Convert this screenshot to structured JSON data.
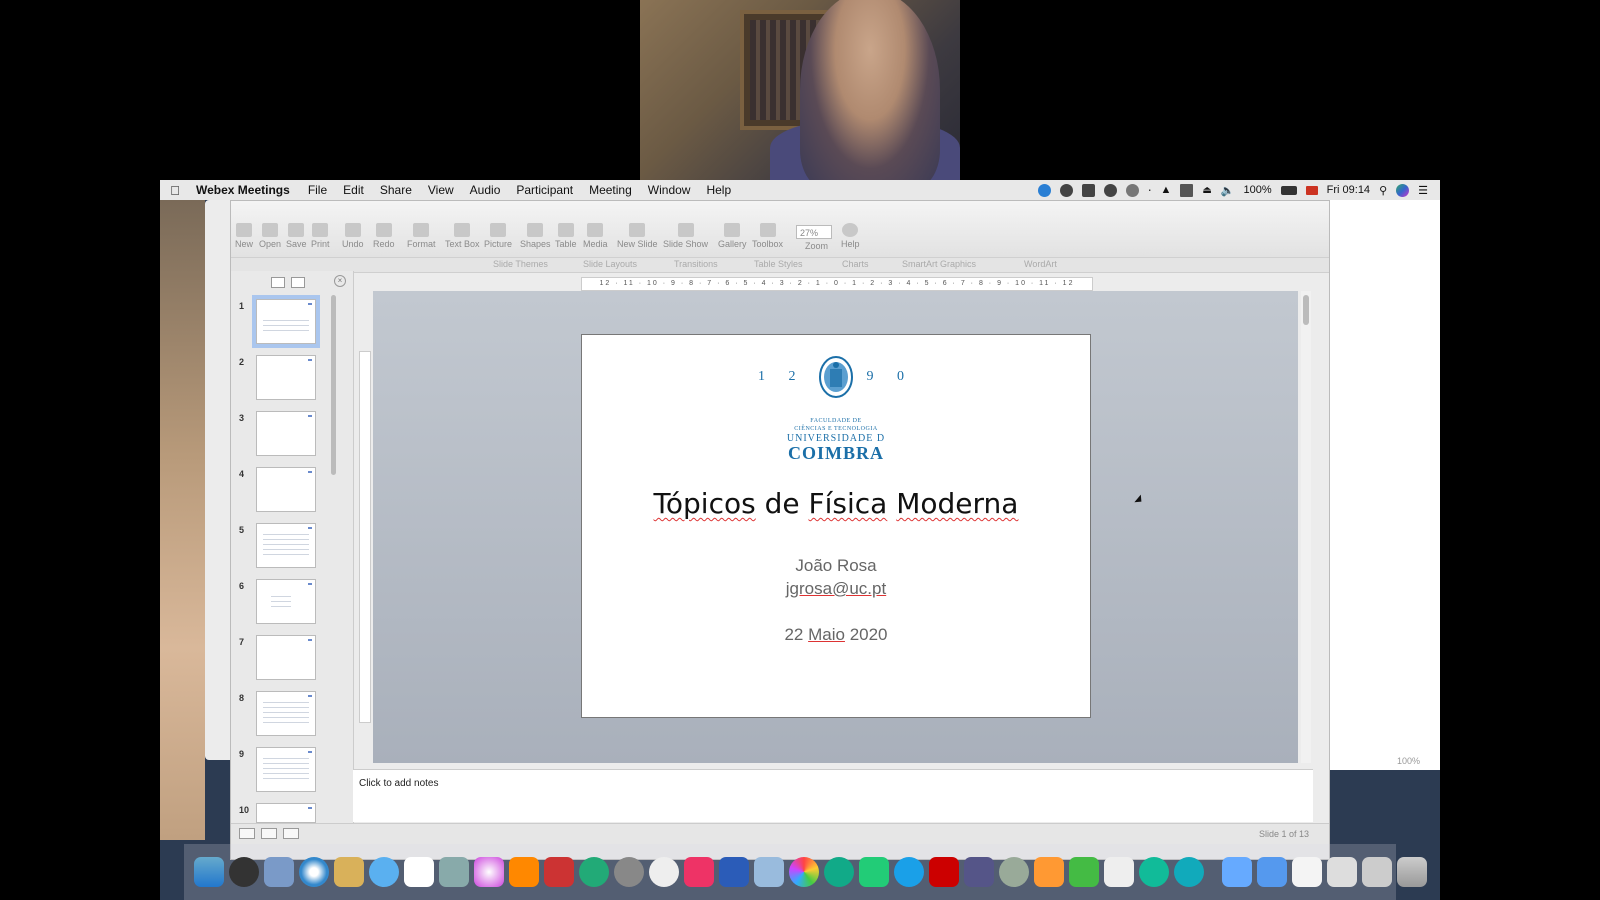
{
  "menubar": {
    "app_name": "Webex Meetings",
    "items": [
      "File",
      "Edit",
      "Share",
      "View",
      "Audio",
      "Participant",
      "Meeting",
      "Window",
      "Help"
    ],
    "battery": "100%",
    "clock": "Fri 09:14"
  },
  "toolbar": {
    "buttons": [
      "New",
      "Open",
      "Save",
      "Print",
      "Undo",
      "Redo",
      "Format",
      "Text Box",
      "Picture",
      "Shapes",
      "Table",
      "Media",
      "New Slide",
      "Slide Show",
      "Gallery",
      "Toolbox",
      "Zoom",
      "Help"
    ],
    "zoom_value": "27%"
  },
  "ribbon": {
    "tabs": [
      "Slide Themes",
      "Slide Layouts",
      "Transitions",
      "Table Styles",
      "Charts",
      "SmartArt Graphics",
      "WordArt"
    ]
  },
  "ruler": {
    "labels": "12 · 11 · 10 · 9 · 8 · 7 · 6 · 5 · 4 · 3 · 2 · 1 · 0 · 1 · 2 · 3 · 4 · 5 · 6 · 7 · 8 · 9 · 10 · 11 · 12"
  },
  "thumbnails": [
    "1",
    "2",
    "3",
    "4",
    "5",
    "6",
    "7",
    "8",
    "9",
    "10"
  ],
  "slide": {
    "year_left": "1 2",
    "year_right": "9 0",
    "faculty_line1": "FACULDADE DE",
    "faculty_line2": "CIÊNCIAS E TECNOLOGIA",
    "university": "UNIVERSIDADE D",
    "city": "COIMBRA",
    "title_word1": "Tópicos",
    "title_word2": " de ",
    "title_word3": "Física",
    "title_word4": " ",
    "title_word5": "Moderna",
    "author": "João Rosa",
    "email": "jgrosa@uc.pt",
    "date_part1": "22 ",
    "date_part2": "Maio",
    "date_part3": " 2020"
  },
  "notes": {
    "placeholder": "Click to add notes"
  },
  "status": {
    "slide_count": "Slide 1 of 13"
  },
  "right_window": {
    "zoom": "100%"
  },
  "dock": {
    "icons": [
      "finder-icon",
      "launchpad-icon",
      "preview-icon",
      "safari-icon",
      "notes-icon",
      "messages-icon",
      "calendar-icon",
      "photos-viewer-icon",
      "itunes-icon",
      "ibooks-icon",
      "photo-booth-icon",
      "time-machine-icon",
      "system-preferences-icon",
      "anki-icon",
      "spark-icon",
      "word-icon",
      "tunnelblick-icon",
      "photos-icon",
      "chrome-icon",
      "skitch-icon",
      "skype-icon",
      "acrobat-icon",
      "texshop-icon",
      "tex-icon",
      "pages-icon",
      "numbers-icon",
      "textedit-icon",
      "webex-icon",
      "webex-meetings-icon",
      "folder-icon",
      "folder-downloads-icon",
      "document-icon",
      "document-stack-icon",
      "window-icon",
      "trash-icon"
    ]
  }
}
